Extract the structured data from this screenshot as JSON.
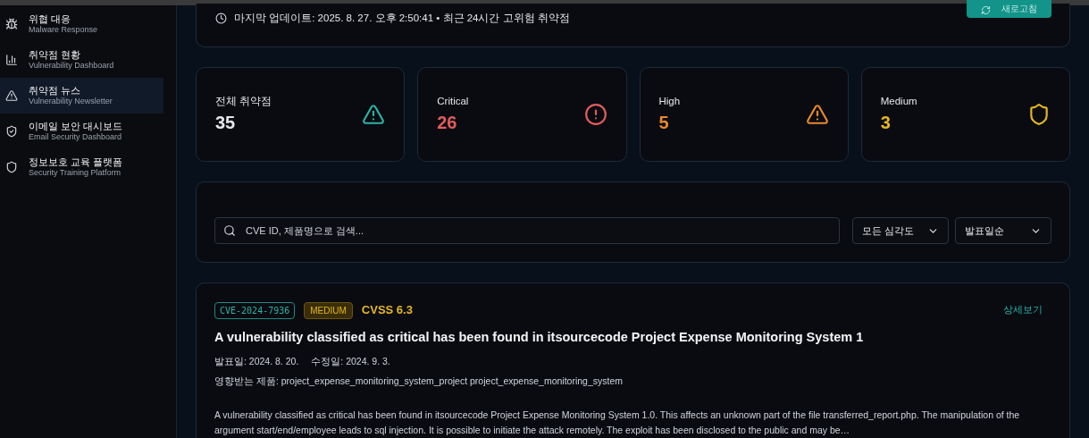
{
  "sidebar": {
    "items": [
      {
        "kind": "bug",
        "title": "위협 대응",
        "subtitle": "Malware Response",
        "selected": false
      },
      {
        "kind": "chart",
        "title": "취약점 현황",
        "subtitle": "Vulnerability Dashboard",
        "selected": false
      },
      {
        "kind": "warning",
        "title": "취약점 뉴스",
        "subtitle": "Vulnerability Newsletter",
        "selected": true
      },
      {
        "kind": "shield-check",
        "title": "이메일 보안 대시보드",
        "subtitle": "Email Security Dashboard",
        "selected": false
      },
      {
        "kind": "shield",
        "title": "정보보호 교육 플랫폼",
        "subtitle": "Security Training Platform",
        "selected": false
      }
    ]
  },
  "header": {
    "updated": "마지막 업데이트: 2025. 8. 27. 오후 2:50:41 • 최근 24시간 고위험 취약점",
    "refresh_button": "새로고침"
  },
  "stats": [
    {
      "label": "전체 취약점",
      "value": "35",
      "kind": "warning",
      "color": "#2bb3a8"
    },
    {
      "label": "Critical",
      "value": "26",
      "kind": "alert-circle",
      "color": "#e25c5c"
    },
    {
      "label": "High",
      "value": "5",
      "kind": "warning",
      "color": "#e8892a"
    },
    {
      "label": "Medium",
      "value": "3",
      "kind": "shield",
      "color": "#e6b622"
    }
  ],
  "filters": {
    "search": {
      "placeholder": "CVE ID, 제품명으로 검색..."
    },
    "severity": "모든 심각도",
    "sort": "발표일순"
  },
  "cve": {
    "id": "CVE-2024-7936",
    "severity": "MEDIUM",
    "cvss": "CVSS 6.3",
    "details_link": "상세보기",
    "title": "A vulnerability classified as critical has been found in itsourcecode Project Expense Monitoring System 1",
    "published": "발표일: 2024. 8. 20.",
    "modified": "수정일: 2024. 9. 3.",
    "products": "영향받는 제품: project_expense_monitoring_system_project project_expense_monitoring_system",
    "description": "A vulnerability classified as critical has been found in itsourcecode Project Expense Monitoring System 1.0. This affects an unknown part of the file transferred_report.php. The manipulation of the argument start/end/employee leads to sql injection. It is possible to initiate the attack remotely. The exploit has been disclosed to the public and may be…"
  }
}
